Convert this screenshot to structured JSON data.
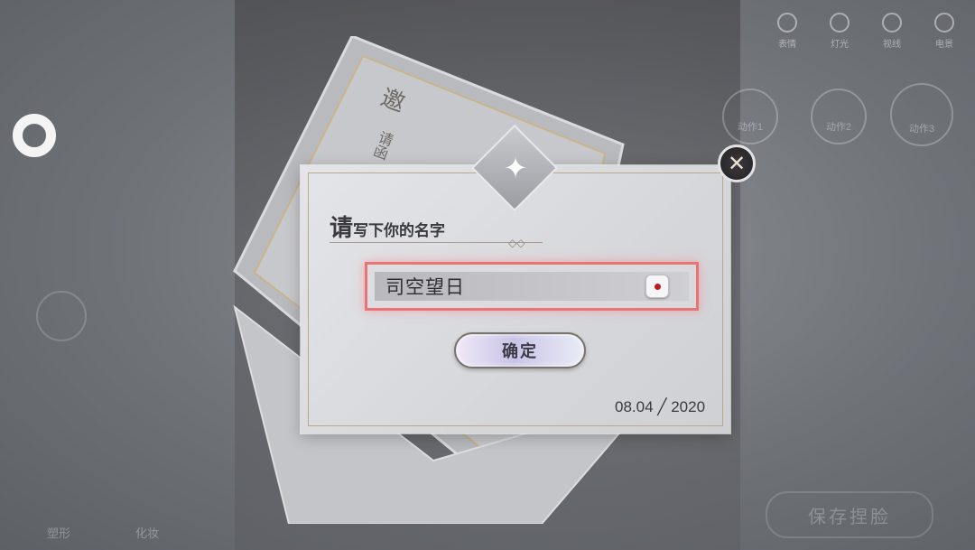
{
  "top_icons": [
    {
      "name": "expression-icon",
      "label": "表情"
    },
    {
      "name": "light-icon",
      "label": "灯光"
    },
    {
      "name": "eye-icon",
      "label": "视线"
    },
    {
      "name": "background-icon",
      "label": "电景"
    }
  ],
  "actions": [
    {
      "label": "动作1"
    },
    {
      "label": "动作2"
    },
    {
      "label": "动作3"
    }
  ],
  "bottom_tabs": [
    "塑形",
    "化妆"
  ],
  "save_button": "保存捏脸",
  "envelope": {
    "title_char": "邀",
    "subtitle": "请函"
  },
  "dialog": {
    "title_first": "请",
    "title_rest": "写下你的名字",
    "name_value": "司空望日",
    "confirm_label": "确定",
    "date": "08.04 ╱ 2020"
  },
  "colors": {
    "highlight": "#eb5a5a",
    "dice_dot": "#c21a22"
  }
}
